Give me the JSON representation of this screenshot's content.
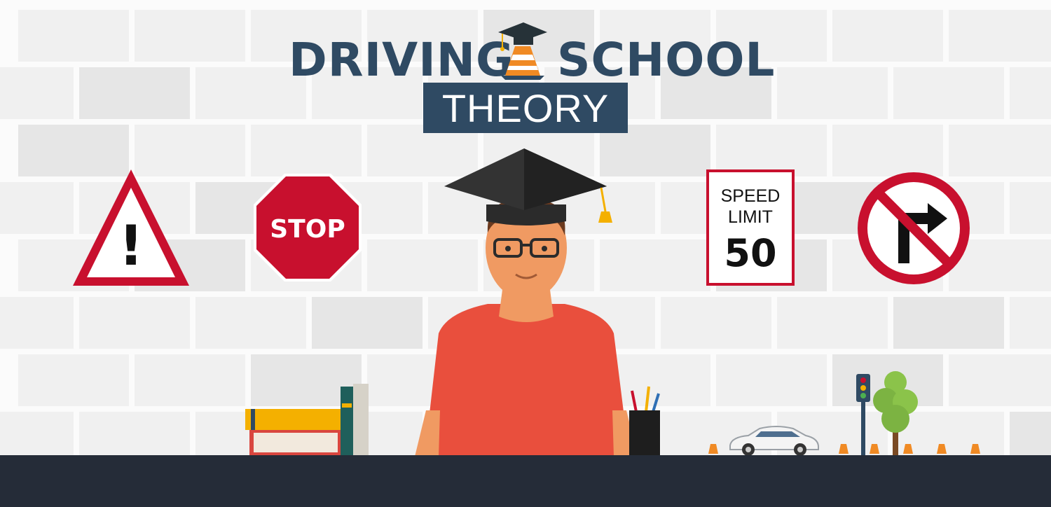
{
  "title": {
    "line1_left": "DRIVING",
    "line1_right": "SCHOOL",
    "line2": "THEORY"
  },
  "signs": {
    "warning": {
      "glyph": "!",
      "icon": "warning-triangle-icon"
    },
    "stop": {
      "text": "STOP",
      "icon": "stop-sign-icon"
    },
    "speed_limit": {
      "line1": "SPEED",
      "line2": "LIMIT",
      "value": "50",
      "icon": "speed-limit-sign-icon"
    },
    "no_right_turn": {
      "icon": "no-right-turn-icon"
    }
  },
  "colors": {
    "title": "#2f4a63",
    "sign_red": "#c8102e",
    "shirt": "#e94f3d",
    "desk": "#252c38",
    "book_yellow": "#f4b000",
    "cone_orange": "#f08a24"
  }
}
